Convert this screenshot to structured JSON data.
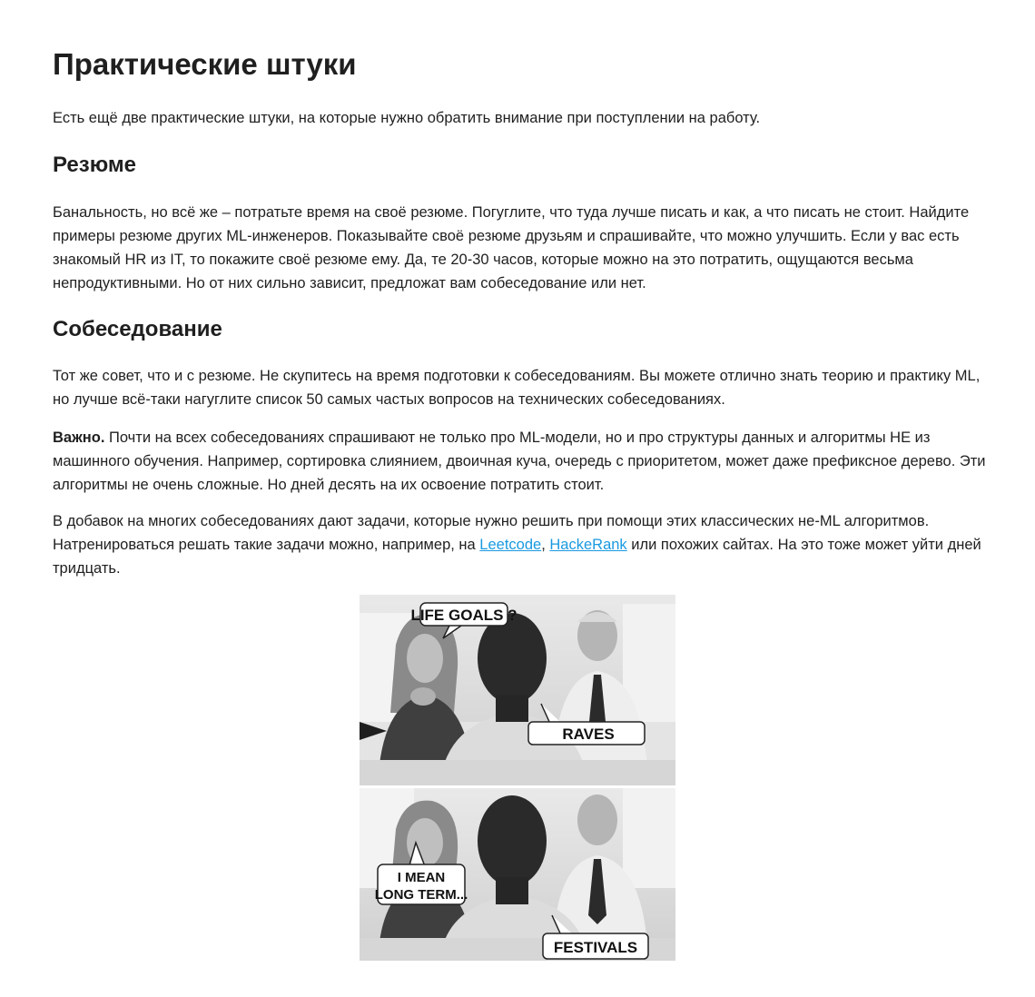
{
  "article": {
    "title": "Практические штуки",
    "intro": "Есть ещё две практические штуки, на которые нужно обратить внимание при поступлении на работу.",
    "resume": {
      "heading": "Резюме",
      "lines": [
        "Банальность, но всё же – потратьте время на своё резюме. Погуглите, что туда лучше писать и как, а что писать не стоит. Найдите",
        "примеры резюме других ML-инженеров. Показывайте своё резюме друзьям и спрашивайте, что можно улучшить. Если у вас есть",
        "знакомый HR из IT, то покажите своё резюме ему. Да, те 20-30 часов, которые можно на это потратить, ощущаются весьма",
        "непродуктивными. Но от них сильно зависит, предложат вам собеседование или нет."
      ]
    },
    "interview": {
      "heading": "Собеседование",
      "advice_lines": [
        "Тот же совет, что и с резюме. Не скупитесь на время подготовки к собеседованиям. Вы можете отлично знать теорию и практику ML,",
        "но лучше всё-таки нагуглите список 50 самых частых вопросов на технических собеседованиях."
      ],
      "important_label": "Важно.",
      "important_line1": " Почти на всех собеседованиях спрашивают не только про ML-модели, но и про структуры данных и алгоритмы НЕ из",
      "important_lines": [
        "машинного обучения. Например, сортировка слиянием, двоичная куча, очередь с приоритетом, может даже префиксное дерево. Эти",
        "алгоритмы не очень сложные. Но дней десять на их освоение потратить стоит."
      ],
      "tasks_line1": "В добавок на многих собеседованиях дают задачи, которые нужно решить при помощи этих классических не-ML алгоритмов.",
      "tasks_line2_before": "Натренироваться решать такие задачи можно, например, на ",
      "link_leetcode": "Leetcode",
      "link_separator": ",",
      "link_hackerank": "HackeRank",
      "tasks_line2_after": " или похожих сайтах. На это тоже может уйти дней",
      "tasks_line3": "тридцать."
    },
    "meme": {
      "bubble_top_woman": "LIFE GOALS ?",
      "bubble_top_man": "RAVES",
      "bubble_bottom_woman_line1": "I MEAN",
      "bubble_bottom_woman_line2": "LONG TERM...",
      "bubble_bottom_man": "FESTIVALS"
    }
  },
  "colors": {
    "text": "#1f1f1f",
    "link": "#1a9ae0",
    "background": "#ffffff"
  }
}
